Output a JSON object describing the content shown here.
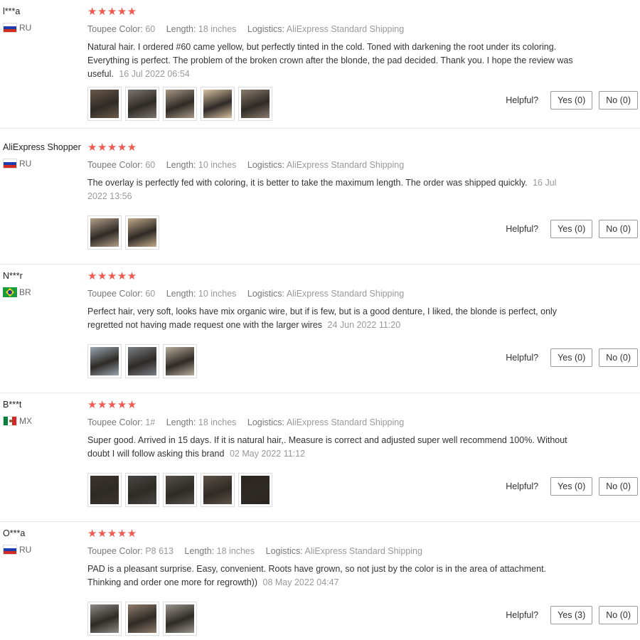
{
  "helpful_label": "Helpful?",
  "star_icon": "★★★★★",
  "reviews": [
    {
      "user": "l***a",
      "country": "RU",
      "flag": "ru",
      "color_label": "Toupee Color:",
      "color": "60",
      "length_label": "Length:",
      "length": "18 inches",
      "logistics_label": "Logistics:",
      "logistics": "AliExpress Standard Shipping",
      "text": "Natural hair. I ordered #60 came yellow, but perfectly tinted in the cold. Toned with darkening the root under its coloring. Everything is perfect. The problem of the broken crown after the blonde, the pad decided. Thank you. I hope the review was useful.",
      "date": "16 Jul 2022 06:54",
      "yes": "Yes (0)",
      "no": "No (0)",
      "photos": [
        "#6b5a4a",
        "#7d7670",
        "#a89884",
        "#d7c0a1",
        "#8a7c6c"
      ]
    },
    {
      "user": "AliExpress Shopper",
      "country": "RU",
      "flag": "ru",
      "color_label": "Toupee Color:",
      "color": "60",
      "length_label": "Length:",
      "length": "10 inches",
      "logistics_label": "Logistics:",
      "logistics": "AliExpress Standard Shipping",
      "text": "The overlay is perfectly fed with coloring, it is better to take the maximum length. The order was shipped quickly.",
      "date": "16 Jul 2022 13:56",
      "yes": "Yes (0)",
      "no": "No (0)",
      "photos": [
        "#b4a089",
        "#c2a98a"
      ]
    },
    {
      "user": "N***r",
      "country": "BR",
      "flag": "br",
      "color_label": "Toupee Color:",
      "color": "60",
      "length_label": "Length:",
      "length": "10 inches",
      "logistics_label": "Logistics:",
      "logistics": "AliExpress Standard Shipping",
      "text": "Perfect hair, very soft, looks have mix organic wire, but if is few, but is a good denture, I liked, the blonde is perfect, only regretted not having made request one with the larger wires",
      "date": "24 Jun 2022 11:20",
      "yes": "Yes (0)",
      "no": "No (0)",
      "photos": [
        "#9aa6b0",
        "#7c7e84",
        "#b7ad9c"
      ]
    },
    {
      "user": "B***t",
      "country": "MX",
      "flag": "mx",
      "color_label": "Toupee Color:",
      "color": "1#",
      "length_label": "Length:",
      "length": "18 inches",
      "logistics_label": "Logistics:",
      "logistics": "AliExpress Standard Shipping",
      "text": "Super good. Arrived in 15 days. If it is natural hair,. Measure is correct and adjusted super well recommend 100%. Without doubt I will follow asking this brand",
      "date": "02 May 2022 11:12",
      "yes": "Yes (0)",
      "no": "No (0)",
      "photos": [
        "#3b3430",
        "#4a4643",
        "#55504b",
        "#5e5246",
        "#2c2520"
      ]
    },
    {
      "user": "O***a",
      "country": "RU",
      "flag": "ru",
      "color_label": "Toupee Color:",
      "color": "P8 613",
      "length_label": "Length:",
      "length": "18 inches",
      "logistics_label": "Logistics:",
      "logistics": "AliExpress Standard Shipping",
      "text": "PAD is a pleasant surprise. Easy, convenient. Roots have grown, so not just by the color is in the area of attachment. Thinking and order one more for regrowth))",
      "date": "08 May 2022 04:47",
      "yes": "Yes (3)",
      "no": "No (0)",
      "photos": [
        "#8e8a86",
        "#8f7d6b",
        "#9b958d"
      ]
    }
  ]
}
